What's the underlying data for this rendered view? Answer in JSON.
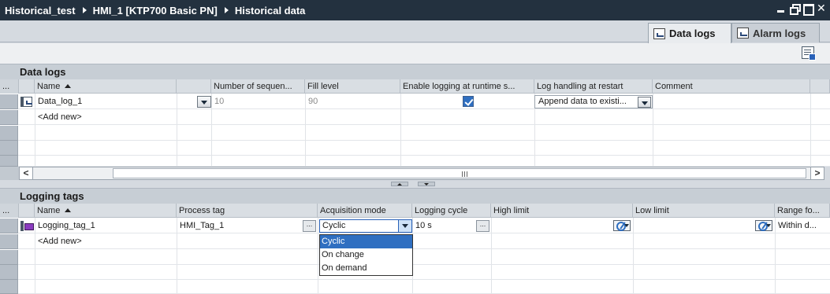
{
  "titlebar": {
    "crumbs": [
      "Historical_test",
      "HMI_1 [KTP700 Basic PN]",
      "Historical data"
    ]
  },
  "tabs": [
    {
      "label": "Data logs",
      "active": true,
      "icon": "data-log-icon"
    },
    {
      "label": "Alarm logs",
      "active": false,
      "icon": "alarm-log-icon"
    }
  ],
  "data_logs": {
    "title": "Data logs",
    "columns": [
      "...",
      "Name",
      "",
      "Number of sequen...",
      "Fill level",
      "Enable logging at runtime s...",
      "Log handling at restart",
      "Comment"
    ],
    "rows": [
      {
        "name": "Data_log_1",
        "number_of_sequences": "10",
        "fill_level": "90",
        "enable_logging": true,
        "log_handling": "Append data to existi...",
        "comment": ""
      }
    ],
    "add_new": "<Add new>"
  },
  "logging_tags": {
    "title": "Logging tags",
    "columns": [
      "...",
      "Name",
      "Process tag",
      "Acquisition mode",
      "Logging cycle",
      "High limit",
      "Low limit",
      "Range fo..."
    ],
    "rows": [
      {
        "name": "Logging_tag_1",
        "process_tag": "HMI_Tag_1",
        "acquisition_mode": "Cyclic",
        "logging_cycle": "10 s",
        "high_limit": "",
        "low_limit": "",
        "range": "Within d..."
      }
    ],
    "add_new": "<Add new>",
    "dropdown_options": [
      "Cyclic",
      "On change",
      "On demand"
    ],
    "dropdown_selected": "Cyclic"
  },
  "colors": {
    "titlebar": "#23313f",
    "selection": "#2f6fc1"
  }
}
